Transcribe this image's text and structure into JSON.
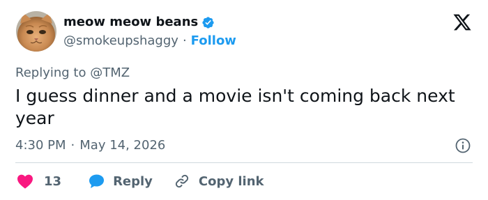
{
  "author": {
    "display_name": "meow meow beans",
    "handle": "@smokeupshaggy",
    "separator": "·",
    "follow_label": "Follow",
    "verified": true,
    "avatar_icon": "orange-cat-avatar"
  },
  "brand": {
    "logo_icon": "x-logo-icon"
  },
  "reply_context": {
    "prefix": "Replying to",
    "mention": "@TMZ"
  },
  "tweet": {
    "text": "I guess dinner and a movie isn't coming back next year",
    "time": "4:30 PM",
    "separator": "·",
    "date": "May 14, 2026"
  },
  "actions": {
    "like_count": "13",
    "reply_label": "Reply",
    "copy_link_label": "Copy link"
  },
  "colors": {
    "accent": "#1d9bf0",
    "like": "#f91880",
    "secondary_text": "#536471",
    "primary_text": "#0f1419",
    "divider": "#cfd9de"
  }
}
